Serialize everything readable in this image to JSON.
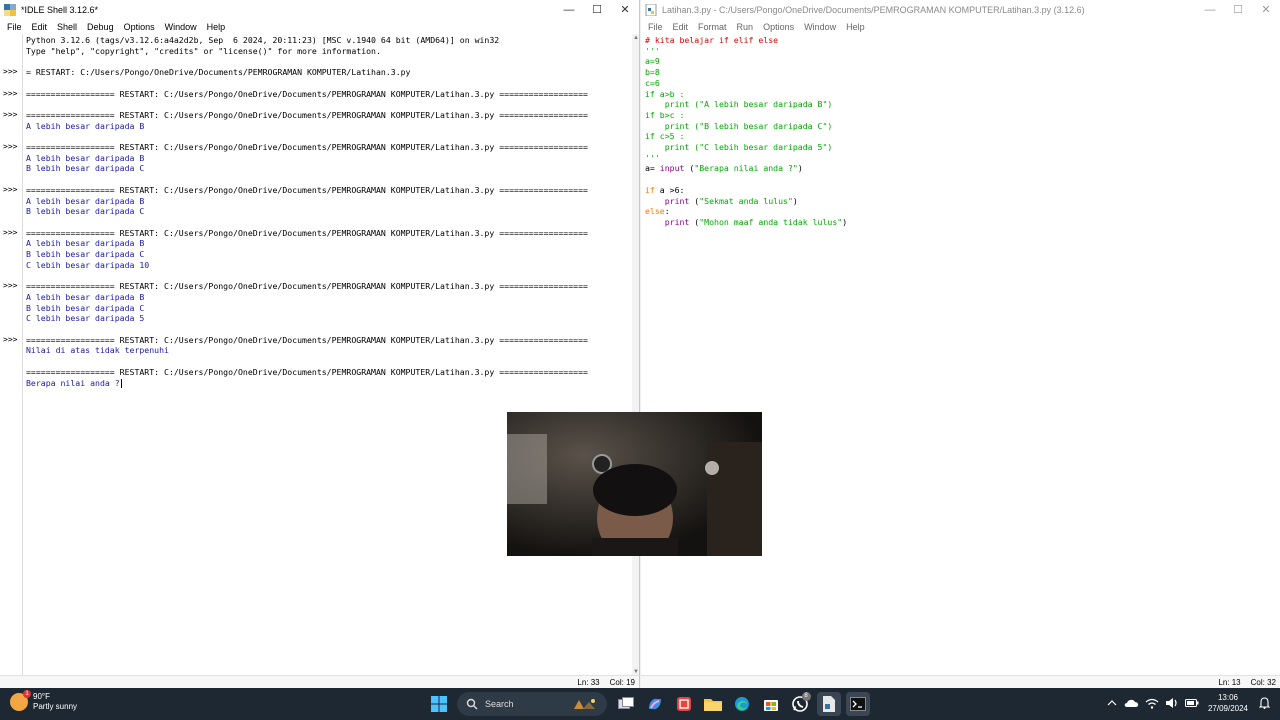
{
  "shell": {
    "title": "*IDLE Shell 3.12.6*",
    "menu": [
      "File",
      "Edit",
      "Shell",
      "Debug",
      "Options",
      "Window",
      "Help"
    ],
    "lines": [
      {
        "t": "Python 3.12.6 (tags/v3.12.6:a4a2d2b, Sep  6 2024, 20:11:23) [MSC v.1940 64 bit (AMD64)] on win32",
        "k": "n"
      },
      {
        "t": "Type \"help\", \"copyright\", \"credits\" or \"license()\" for more information.",
        "k": "n"
      },
      {
        "t": "",
        "k": "n"
      },
      {
        "t": "= RESTART: C:/Users/Pongo/OneDrive/Documents/PEMROGRAMAN KOMPUTER/Latihan.3.py",
        "k": "n"
      },
      {
        "t": "",
        "k": "n"
      },
      {
        "t": "================== RESTART: C:/Users/Pongo/OneDrive/Documents/PEMROGRAMAN KOMPUTER/Latihan.3.py ==================",
        "k": "n"
      },
      {
        "t": "",
        "k": "n"
      },
      {
        "t": "================== RESTART: C:/Users/Pongo/OneDrive/Documents/PEMROGRAMAN KOMPUTER/Latihan.3.py ==================",
        "k": "n"
      },
      {
        "t": "A lebih besar daripada B",
        "k": "o"
      },
      {
        "t": "",
        "k": "n"
      },
      {
        "t": "================== RESTART: C:/Users/Pongo/OneDrive/Documents/PEMROGRAMAN KOMPUTER/Latihan.3.py ==================",
        "k": "n"
      },
      {
        "t": "A lebih besar daripada B",
        "k": "o"
      },
      {
        "t": "B lebih besar daripada C",
        "k": "o"
      },
      {
        "t": "",
        "k": "n"
      },
      {
        "t": "================== RESTART: C:/Users/Pongo/OneDrive/Documents/PEMROGRAMAN KOMPUTER/Latihan.3.py ==================",
        "k": "n"
      },
      {
        "t": "A lebih besar daripada B",
        "k": "o"
      },
      {
        "t": "B lebih besar daripada C",
        "k": "o"
      },
      {
        "t": "",
        "k": "n"
      },
      {
        "t": "================== RESTART: C:/Users/Pongo/OneDrive/Documents/PEMROGRAMAN KOMPUTER/Latihan.3.py ==================",
        "k": "n"
      },
      {
        "t": "A lebih besar daripada B",
        "k": "o"
      },
      {
        "t": "B lebih besar daripada C",
        "k": "o"
      },
      {
        "t": "C lebih besar daripada 10",
        "k": "o"
      },
      {
        "t": "",
        "k": "n"
      },
      {
        "t": "================== RESTART: C:/Users/Pongo/OneDrive/Documents/PEMROGRAMAN KOMPUTER/Latihan.3.py ==================",
        "k": "n"
      },
      {
        "t": "A lebih besar daripada B",
        "k": "o"
      },
      {
        "t": "B lebih besar daripada C",
        "k": "o"
      },
      {
        "t": "C lebih besar daripada 5",
        "k": "o"
      },
      {
        "t": "",
        "k": "n"
      },
      {
        "t": "================== RESTART: C:/Users/Pongo/OneDrive/Documents/PEMROGRAMAN KOMPUTER/Latihan.3.py ==================",
        "k": "n"
      },
      {
        "t": "Nilai di atas tidak terpenuhi",
        "k": "o"
      },
      {
        "t": "",
        "k": "n"
      },
      {
        "t": "================== RESTART: C:/Users/Pongo/OneDrive/Documents/PEMROGRAMAN KOMPUTER/Latihan.3.py ==================",
        "k": "n"
      },
      {
        "t": "Berapa nilai anda ?",
        "k": "o"
      }
    ],
    "prompts": [
      ">>>",
      ">>>",
      ">>>",
      ">>>",
      ">>>",
      ">>>",
      ">>>",
      ">>>"
    ],
    "status_line": "Ln: 33",
    "status_col": "Col: 19"
  },
  "editor": {
    "title": "Latihan.3.py - C:/Users/Pongo/OneDrive/Documents/PEMROGRAMAN KOMPUTER/Latihan.3.py (3.12.6)",
    "menu": [
      "File",
      "Edit",
      "Format",
      "Run",
      "Options",
      "Window",
      "Help"
    ],
    "code": [
      [
        {
          "t": "# kita belajar if elif else",
          "c": "comment"
        }
      ],
      [
        {
          "t": "'''",
          "c": "str"
        }
      ],
      [
        {
          "t": "a=9",
          "c": "str"
        }
      ],
      [
        {
          "t": "b=8",
          "c": "str"
        }
      ],
      [
        {
          "t": "c=6",
          "c": "str"
        }
      ],
      [
        {
          "t": "if a>b :",
          "c": "str"
        }
      ],
      [
        {
          "t": "    print (\"A lebih besar daripada B\")",
          "c": "str"
        }
      ],
      [
        {
          "t": "if b>c :",
          "c": "str"
        }
      ],
      [
        {
          "t": "    print (\"B lebih besar daripada C\")",
          "c": "str"
        }
      ],
      [
        {
          "t": "if c>5 :",
          "c": "str"
        }
      ],
      [
        {
          "t": "    print (\"C lebih besar daripada 5\")",
          "c": "str"
        }
      ],
      [
        {
          "t": "'''",
          "c": "str"
        }
      ],
      [
        {
          "t": "a= ",
          "c": ""
        },
        {
          "t": "input",
          "c": "builtin"
        },
        {
          "t": " (",
          "c": ""
        },
        {
          "t": "\"Berapa nilai anda ?\"",
          "c": "str"
        },
        {
          "t": ")",
          "c": ""
        }
      ],
      [
        {
          "t": "",
          "c": ""
        }
      ],
      [
        {
          "t": "if",
          "c": "kw"
        },
        {
          "t": " a >6:",
          "c": ""
        }
      ],
      [
        {
          "t": "    ",
          "c": ""
        },
        {
          "t": "print",
          "c": "builtin"
        },
        {
          "t": " (",
          "c": ""
        },
        {
          "t": "\"Sekmat anda lulus\"",
          "c": "str"
        },
        {
          "t": ")",
          "c": ""
        }
      ],
      [
        {
          "t": "else",
          "c": "kw"
        },
        {
          "t": ":",
          "c": ""
        }
      ],
      [
        {
          "t": "    ",
          "c": ""
        },
        {
          "t": "print",
          "c": "builtin"
        },
        {
          "t": " (",
          "c": ""
        },
        {
          "t": "\"Mohon maaf anda tidak lulus\"",
          "c": "str"
        },
        {
          "t": ")",
          "c": ""
        }
      ]
    ],
    "status_line": "Ln: 13",
    "status_col": "Col: 32"
  },
  "taskbar": {
    "weather_temp": "90°F",
    "weather_desc": "Partly sunny",
    "weather_badge": "1",
    "search_label": "Search",
    "whatsapp_badge": "8",
    "time": "13:06",
    "date": "27/09/2024"
  },
  "colors": {
    "shell_output": "#1a1aaa",
    "comment": "#dd0000",
    "keyword": "#ff7700",
    "string": "#00aa00",
    "builtin": "#900090",
    "taskbar": "#1e2833"
  }
}
